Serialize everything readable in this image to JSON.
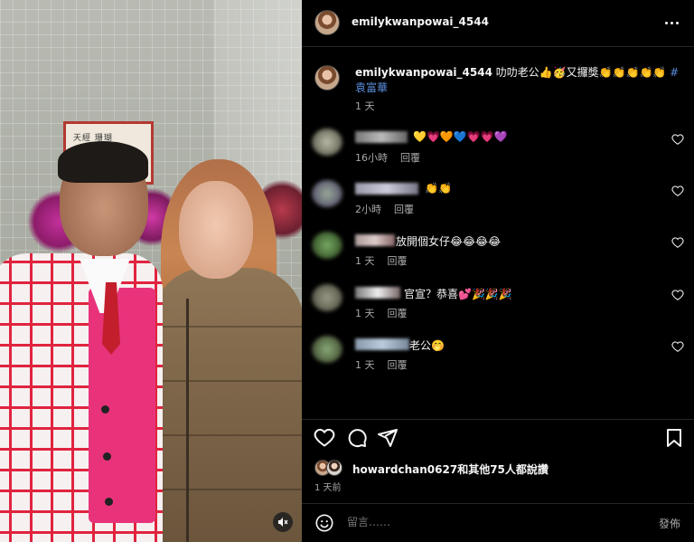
{
  "post": {
    "username": "emilykwanpowai_4544",
    "more_icon": "more-horizontal-icon"
  },
  "caption": {
    "username": "emilykwanpowai_4544",
    "text": " 叻叻老公👍🥳又攞獎👏👏👏👏👏 ",
    "hashtag": "#袁富華",
    "time": "1 天"
  },
  "comments": [
    {
      "text": "💛💗🧡💙💗💗💜",
      "time": "16小時",
      "reply": "回覆"
    },
    {
      "text": "👏👏",
      "time": "2小時",
      "reply": "回覆"
    },
    {
      "text": " 放開個女仔😂😂😂😂",
      "time": "1 天",
      "reply": "回覆"
    },
    {
      "text": "官宣？恭喜💕🎉🎉🎉",
      "time": "1 天",
      "reply": "回覆"
    },
    {
      "text": " 老公🤭",
      "time": "1 天",
      "reply": "回覆"
    }
  ],
  "actions": {
    "like_icon": "heart-icon",
    "comment_icon": "comment-icon",
    "share_icon": "send-icon",
    "save_icon": "bookmark-icon"
  },
  "likes": {
    "user": "howardchan0627",
    "rest": "和其他75人都說讚"
  },
  "post_time": "1 天前",
  "comment_bar": {
    "placeholder": "留言……",
    "post_label": "發佈"
  },
  "photo": {
    "plaque_text": "天經 珊瑚",
    "mute_icon": "speaker-muted-icon"
  }
}
